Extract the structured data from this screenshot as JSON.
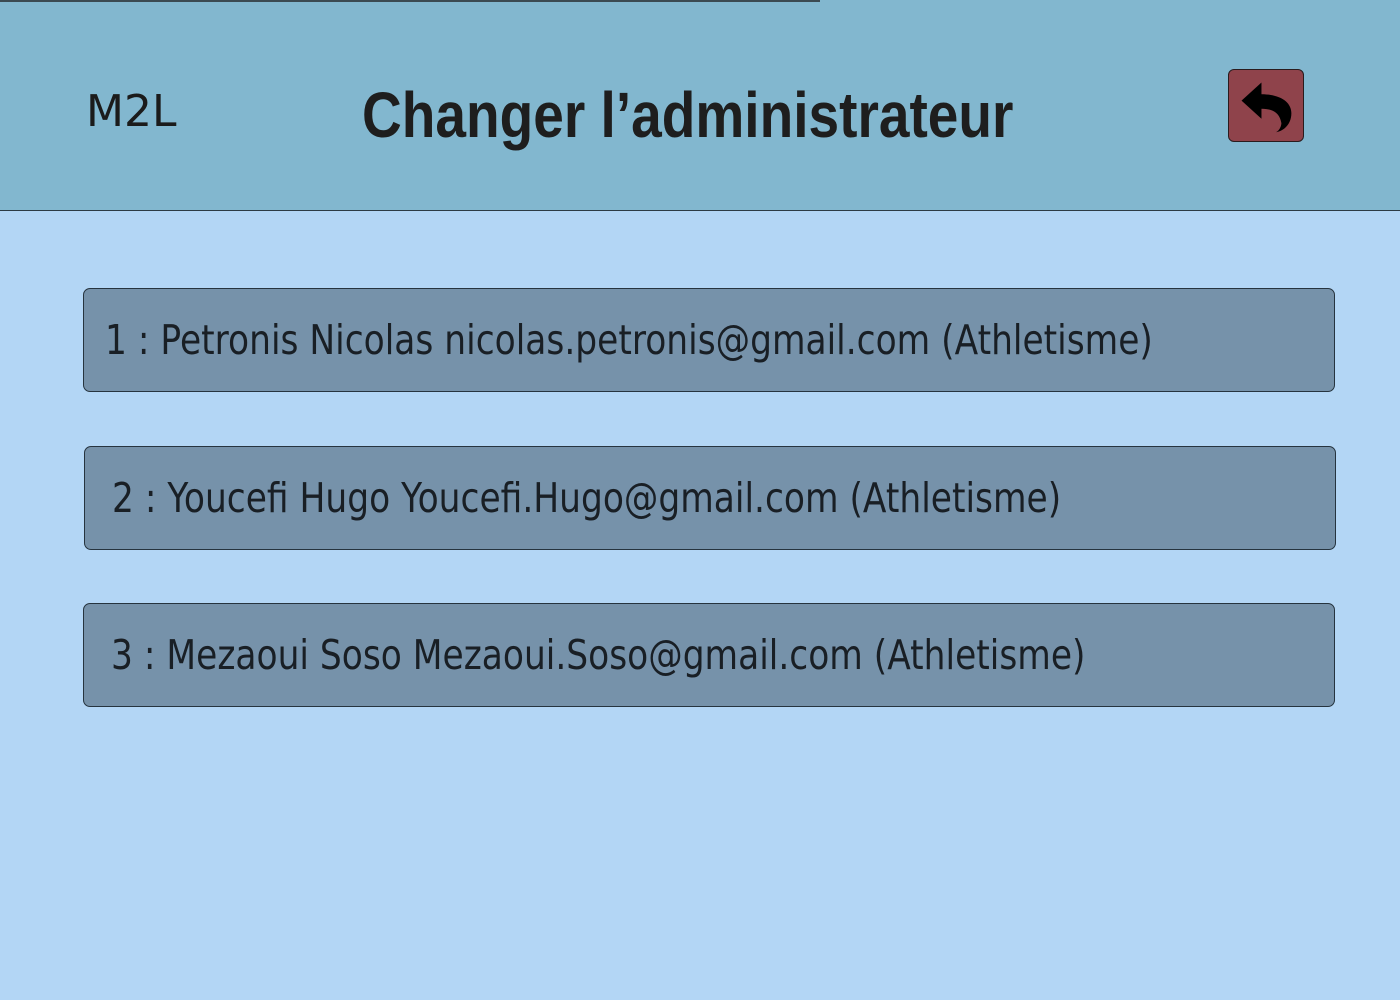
{
  "header": {
    "brand": "M2L",
    "title": "Changer l’administrateur",
    "back_icon": "undo-arrow-icon",
    "back_button_color": "#8f434b"
  },
  "admins": [
    {
      "label": "1 : Petronis Nicolas nicolas.petronis@gmail.com (Athletisme)"
    },
    {
      "label": "2 : Youcefi Hugo Youcefi.Hugo@gmail.com (Athletisme)"
    },
    {
      "label": "3 : Mezaoui Soso Mezaoui.Soso@gmail.com (Athletisme)"
    }
  ],
  "colors": {
    "header_background": "#82b7cf",
    "page_background": "#b3d6f5",
    "item_background": "#7692aa"
  }
}
